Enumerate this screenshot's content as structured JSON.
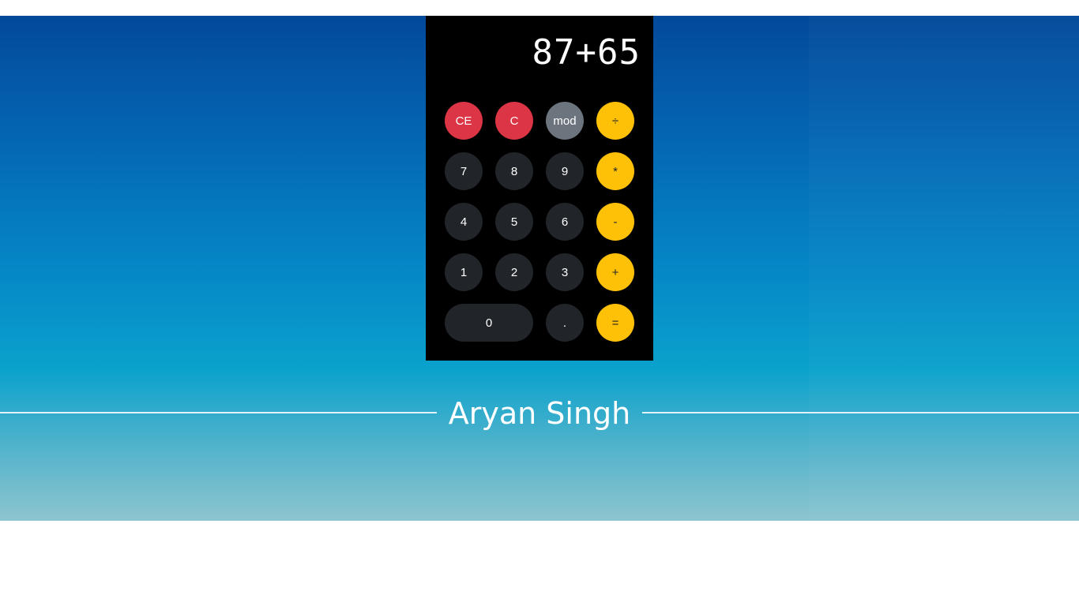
{
  "calculator": {
    "display": "87+65",
    "buttons": {
      "ce": "CE",
      "c": "C",
      "mod": "mod",
      "divide": "÷",
      "seven": "7",
      "eight": "8",
      "nine": "9",
      "multiply": "*",
      "four": "4",
      "five": "5",
      "six": "6",
      "minus": "-",
      "one": "1",
      "two": "2",
      "three": "3",
      "plus": "+",
      "zero": "0",
      "dot": ".",
      "equals": "="
    }
  },
  "footer": {
    "name": "Aryan Singh"
  },
  "colors": {
    "danger": "#dc3545",
    "secondary": "#6c757d",
    "warning": "#ffc107",
    "dark": "#212529"
  }
}
